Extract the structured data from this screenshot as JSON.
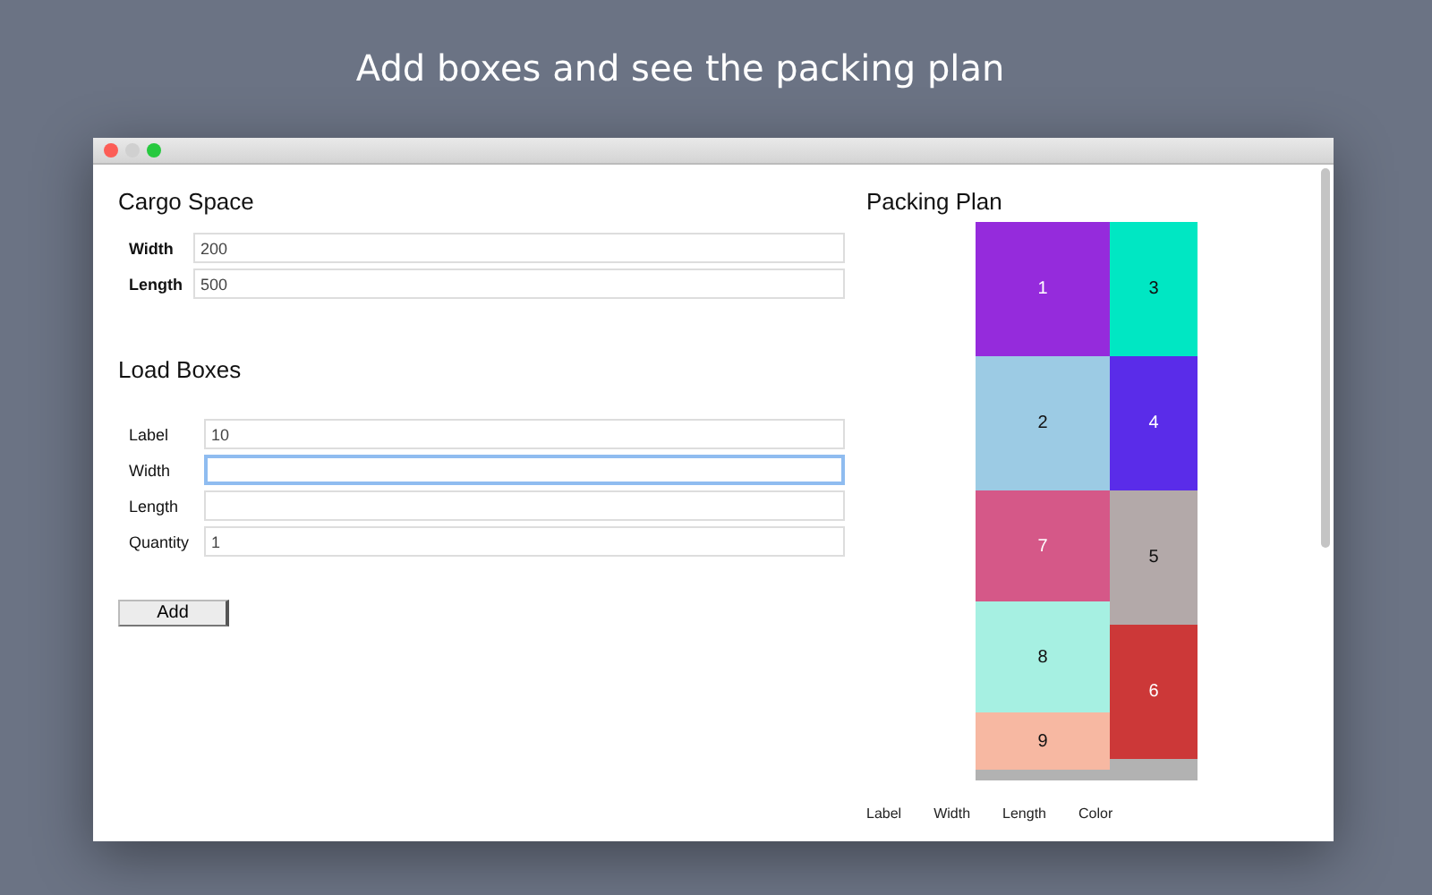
{
  "headline": "Add boxes and see the packing plan",
  "cargo_space": {
    "title": "Cargo Space",
    "fields": [
      {
        "label": "Width",
        "value": "200"
      },
      {
        "label": "Length",
        "value": "500"
      }
    ]
  },
  "load_boxes": {
    "title": "Load Boxes",
    "fields": [
      {
        "label": "Label",
        "value": "10",
        "focused": false
      },
      {
        "label": "Width",
        "focused": true
      },
      {
        "label": "Length",
        "focused": false
      },
      {
        "label": "Quantity",
        "value": "1",
        "focused": false
      }
    ],
    "button": "Add"
  },
  "packing_plan": {
    "title": "Packing Plan",
    "columns": [
      {
        "boxes": [
          {
            "label": "1",
            "color": "#952bdc",
            "kind": "large"
          },
          {
            "label": "2",
            "color": "#9ccbe4",
            "kind": "large"
          },
          {
            "label": "7",
            "color": "#d55888",
            "kind": "medium"
          },
          {
            "label": "8",
            "color": "#a6f0e2",
            "kind": "medium"
          },
          {
            "label": "9",
            "color": "#f7b8a2",
            "kind": "small"
          }
        ]
      },
      {
        "boxes": [
          {
            "label": "3",
            "color": "#00e7c3",
            "kind": "large"
          },
          {
            "label": "4",
            "color": "#5a2ce9",
            "kind": "large"
          },
          {
            "label": "5",
            "color": "#b3a9a9",
            "kind": "large"
          },
          {
            "label": "6",
            "color": "#cc3838",
            "kind": "large"
          }
        ]
      }
    ],
    "table_headers": [
      "Label",
      "Width",
      "Length",
      "Color"
    ]
  }
}
